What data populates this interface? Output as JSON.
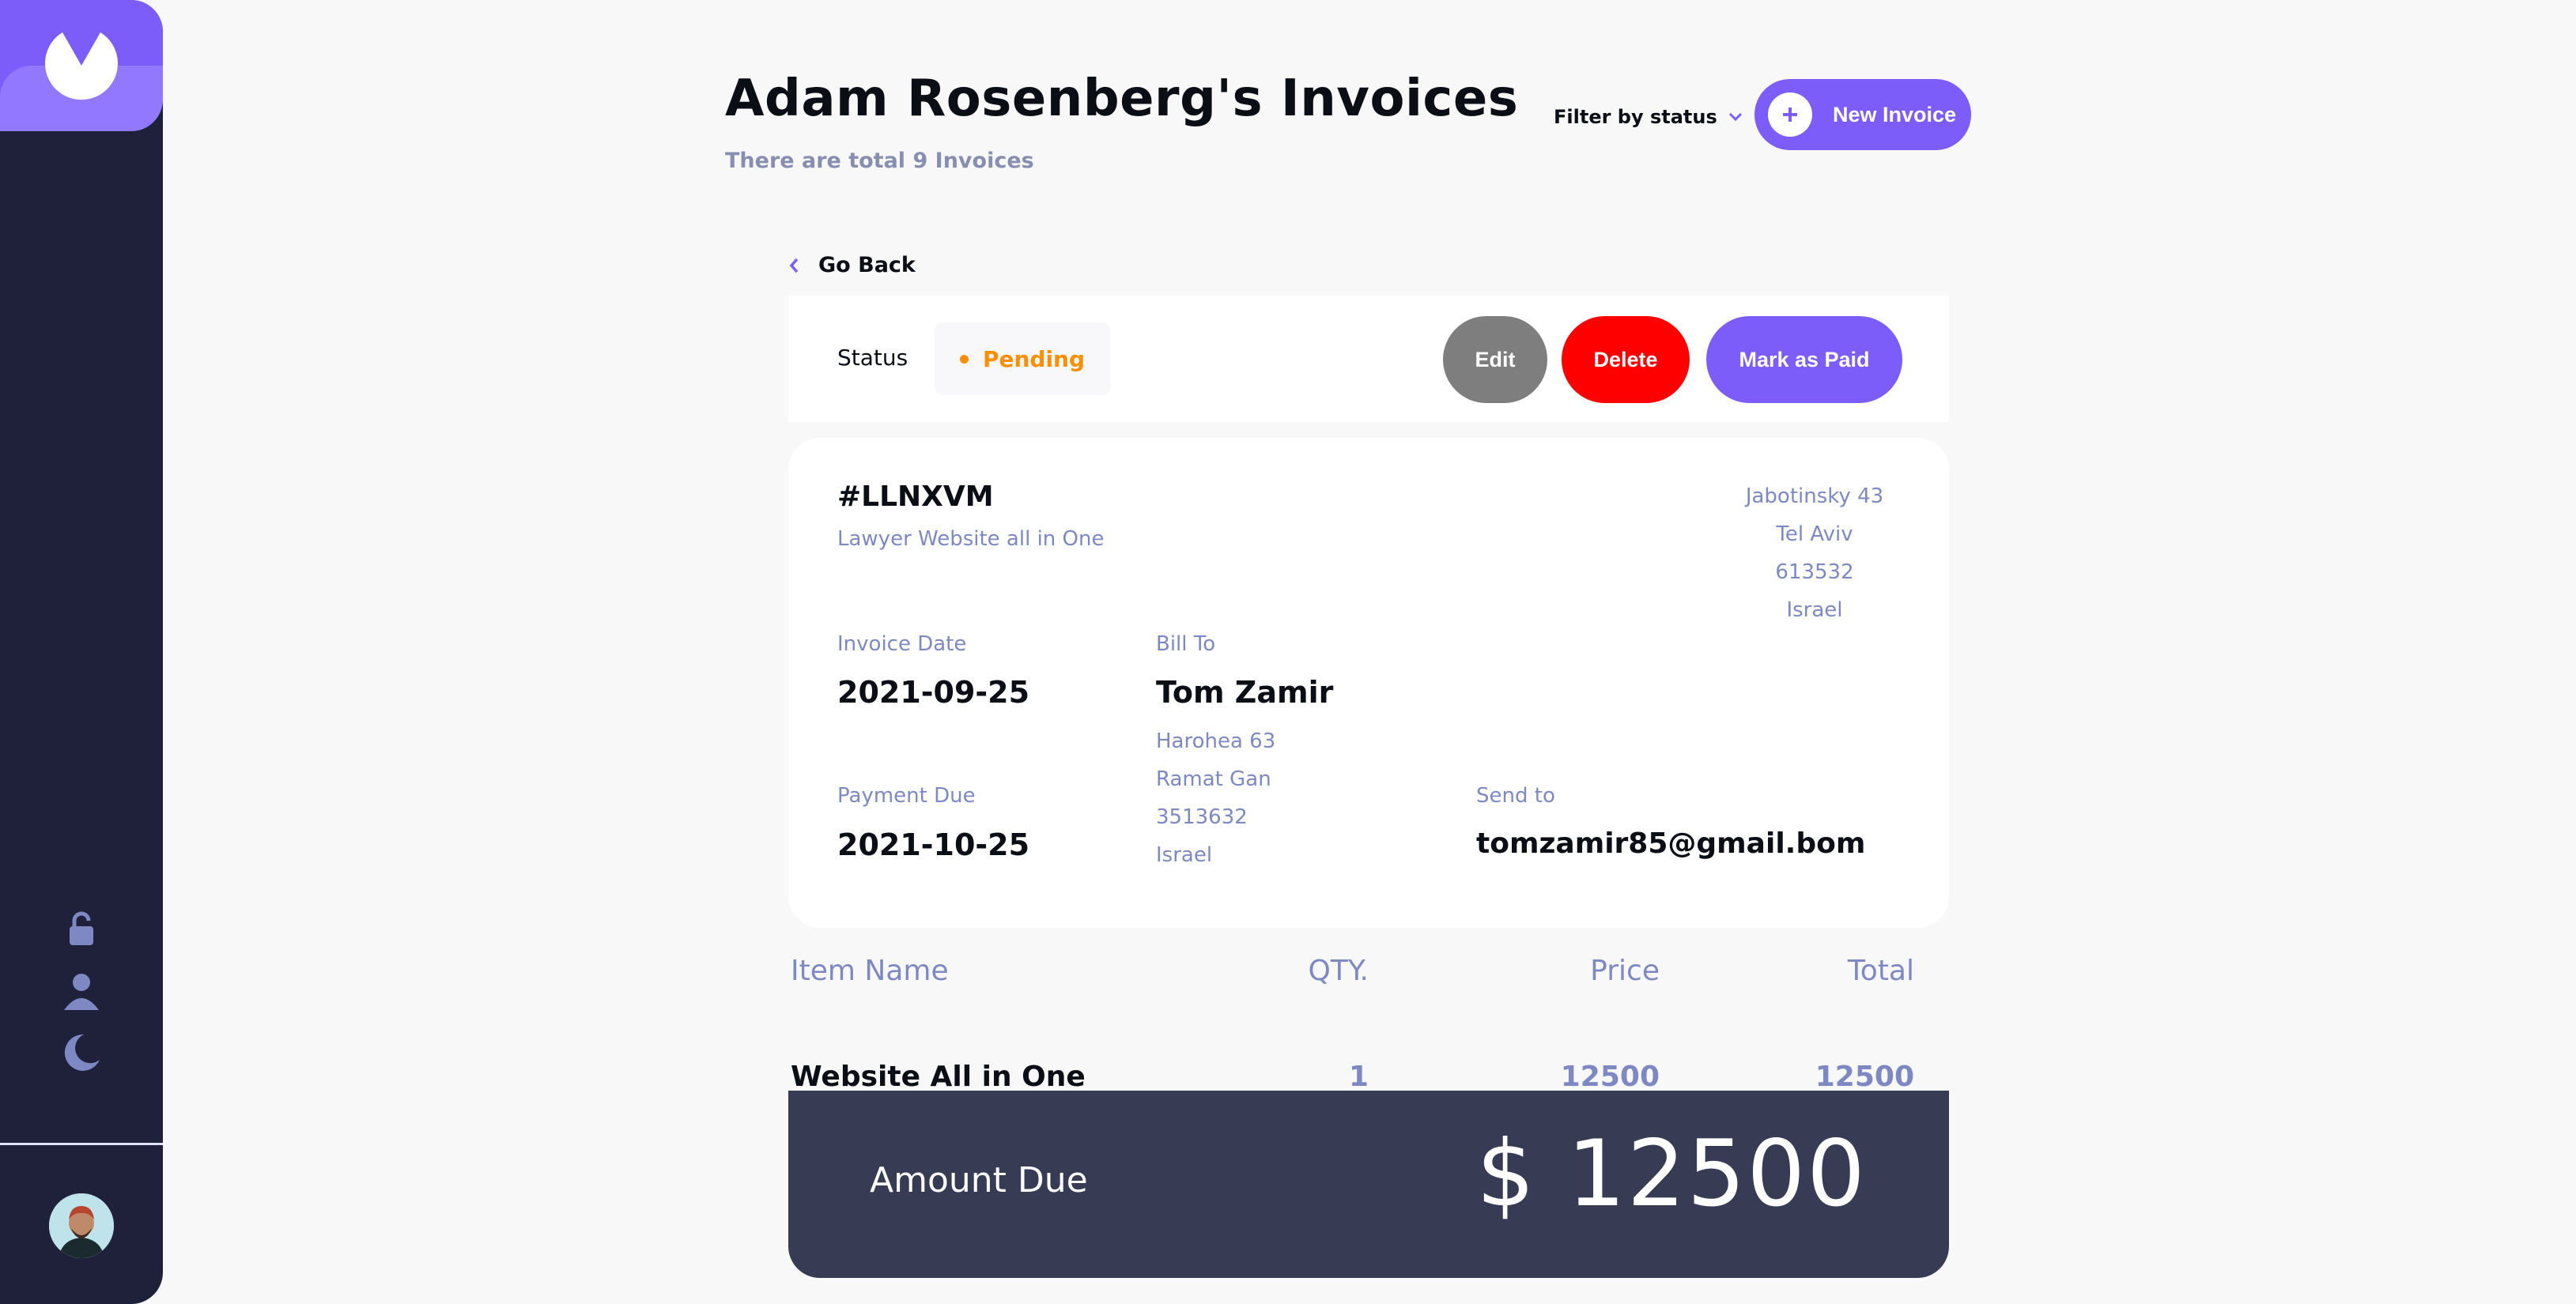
{
  "header": {
    "title": "Adam Rosenberg's Invoices",
    "subtitle": "There are total 9 Invoices",
    "filter_label": "Filter by status",
    "new_invoice_label": "New Invoice"
  },
  "nav": {
    "go_back": "Go Back"
  },
  "status_bar": {
    "label": "Status",
    "status": "Pending",
    "edit_label": "Edit",
    "delete_label": "Delete",
    "mark_paid_label": "Mark as Paid"
  },
  "invoice": {
    "id": "#LLNXVM",
    "description": "Lawyer Website all in One",
    "sender_address": {
      "street": "Jabotinsky 43",
      "city": "Tel Aviv",
      "postcode": "613532",
      "country": "Israel"
    },
    "invoice_date_label": "Invoice Date",
    "invoice_date": "2021-09-25",
    "payment_due_label": "Payment Due",
    "payment_due": "2021-10-25",
    "bill_to_label": "Bill To",
    "client_name": "Tom Zamir",
    "client_address": {
      "street": "Harohea 63",
      "city": "Ramat Gan",
      "postcode": "3513632",
      "country": "Israel"
    },
    "send_to_label": "Send to",
    "client_email": "tomzamir85@gmail.bom"
  },
  "items": {
    "headers": {
      "name": "Item Name",
      "qty": "QTY.",
      "price": "Price",
      "total": "Total"
    },
    "rows": [
      {
        "name": "Website All in One",
        "qty": "1",
        "price": "12500",
        "total": "12500"
      }
    ]
  },
  "amount": {
    "label": "Amount Due",
    "value": "$ 12500"
  },
  "colors": {
    "accent": "#7c5dfa",
    "sidebar": "#1f213a",
    "pending": "#ff8f00",
    "delete": "#ff0000",
    "edit": "#7e7e7e",
    "amount_bg": "#373b53"
  },
  "icons": {
    "logo": "logo-icon",
    "lock": "lock-icon",
    "user": "user-icon",
    "theme": "moon-icon",
    "filter": "chevron-down-icon",
    "back": "chevron-left-icon",
    "new": "plus-icon"
  }
}
